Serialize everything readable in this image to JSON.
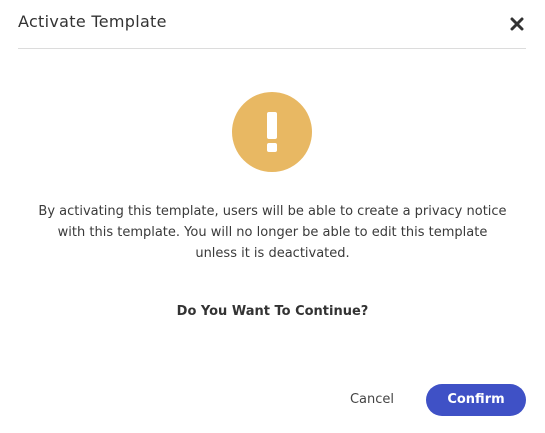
{
  "dialog": {
    "title": "Activate Template",
    "close_icon": "close-icon",
    "warning_icon": "exclamation-icon",
    "warning_color": "#e8b863",
    "message_lines": [
      "By activating this template, users will be able to create a privacy notice",
      "with this template. You will no longer be able to edit this template",
      "unless it is deactivated."
    ],
    "question": "Do You Want To Continue?",
    "cancel_label": "Cancel",
    "confirm_label": "Confirm",
    "confirm_color": "#3f51c6"
  }
}
